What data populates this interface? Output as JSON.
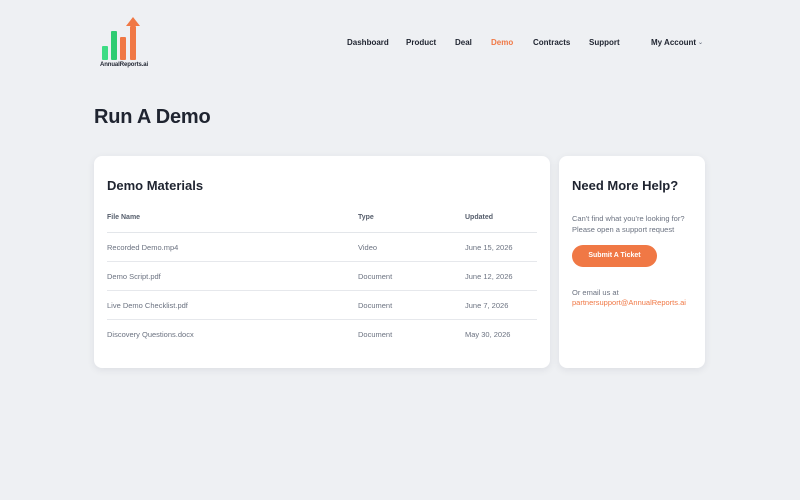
{
  "brand": {
    "name": "AnnualReports.ai",
    "bar_colors": [
      "#3ddc84",
      "#2ecc71",
      "#f07845"
    ]
  },
  "nav": {
    "items": [
      "Dashboard",
      "Product",
      "Deal",
      "Demo",
      "Contracts",
      "Support"
    ],
    "active": "Demo",
    "account_label": "My Account",
    "account_icon": "chevron-down-icon"
  },
  "page": {
    "title": "Run A Demo"
  },
  "materials": {
    "title": "Demo Materials",
    "columns": [
      "File Name",
      "Type",
      "Updated"
    ],
    "rows": [
      {
        "file": "Recorded Demo.mp4",
        "type": "Video",
        "updated": "June 15, 2026"
      },
      {
        "file": "Demo Script.pdf",
        "type": "Document",
        "updated": "June 12, 2026"
      },
      {
        "file": "Live Demo Checklist.pdf",
        "type": "Document",
        "updated": "June 7, 2026"
      },
      {
        "file": "Discovery Questions.docx",
        "type": "Document",
        "updated": "May 30, 2026"
      }
    ]
  },
  "help": {
    "title": "Need More Help?",
    "text": "Can't find what you're looking for? Please open a support request",
    "button_label": "Submit A Ticket",
    "email_label": "Or email us at",
    "email": "partnersupport@AnnualReports.ai"
  },
  "colors": {
    "accent": "#f07845",
    "background": "#eef0f3",
    "card": "#ffffff",
    "text": "#1f2430",
    "muted": "#6b7280"
  }
}
